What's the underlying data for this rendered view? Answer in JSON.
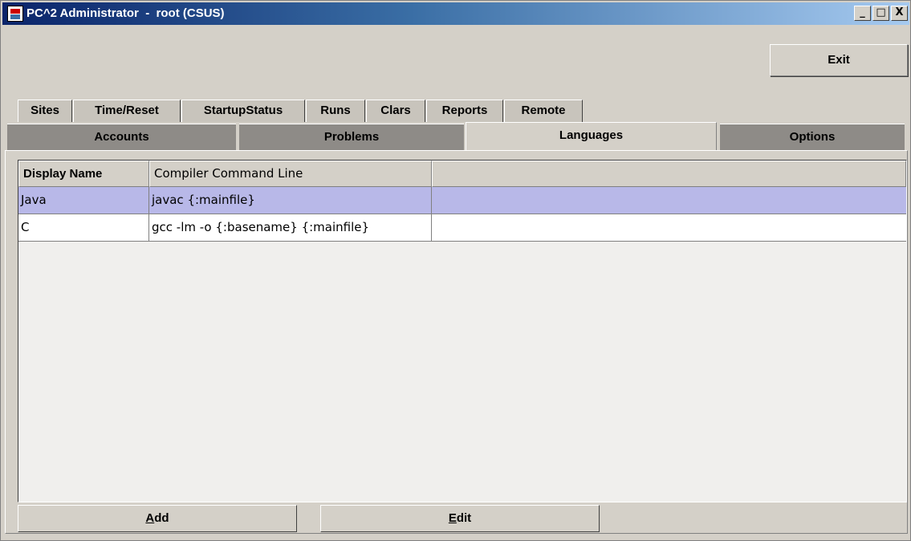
{
  "window": {
    "title": "PC^2 Administrator  -  root (CSUS)",
    "controls": {
      "minimize": "_",
      "maximize": "□",
      "close": "X"
    }
  },
  "toolbar": {
    "exit_label": "Exit"
  },
  "top_tabs": [
    "Sites",
    "Time/Reset",
    "StartupStatus",
    "Runs",
    "Clars",
    "Reports",
    "Remote"
  ],
  "main_tabs": [
    "Accounts",
    "Problems",
    "Languages",
    "Options"
  ],
  "active_main_tab": "Languages",
  "table": {
    "columns": [
      "Display Name",
      "Compiler Command Line",
      ""
    ],
    "rows": [
      {
        "display_name": "Java",
        "compiler_command": "javac {:mainfile}",
        "selected": true
      },
      {
        "display_name": "C",
        "compiler_command": "gcc -lm -o {:basename} {:mainfile}",
        "selected": false
      }
    ]
  },
  "actions": {
    "add": {
      "mnemonic": "A",
      "rest": "dd"
    },
    "edit": {
      "mnemonic": "E",
      "rest": "dit"
    }
  },
  "colors": {
    "selection": "#b8b8e8",
    "titlebar_start": "#0a246a",
    "titlebar_end": "#a6caf0"
  }
}
